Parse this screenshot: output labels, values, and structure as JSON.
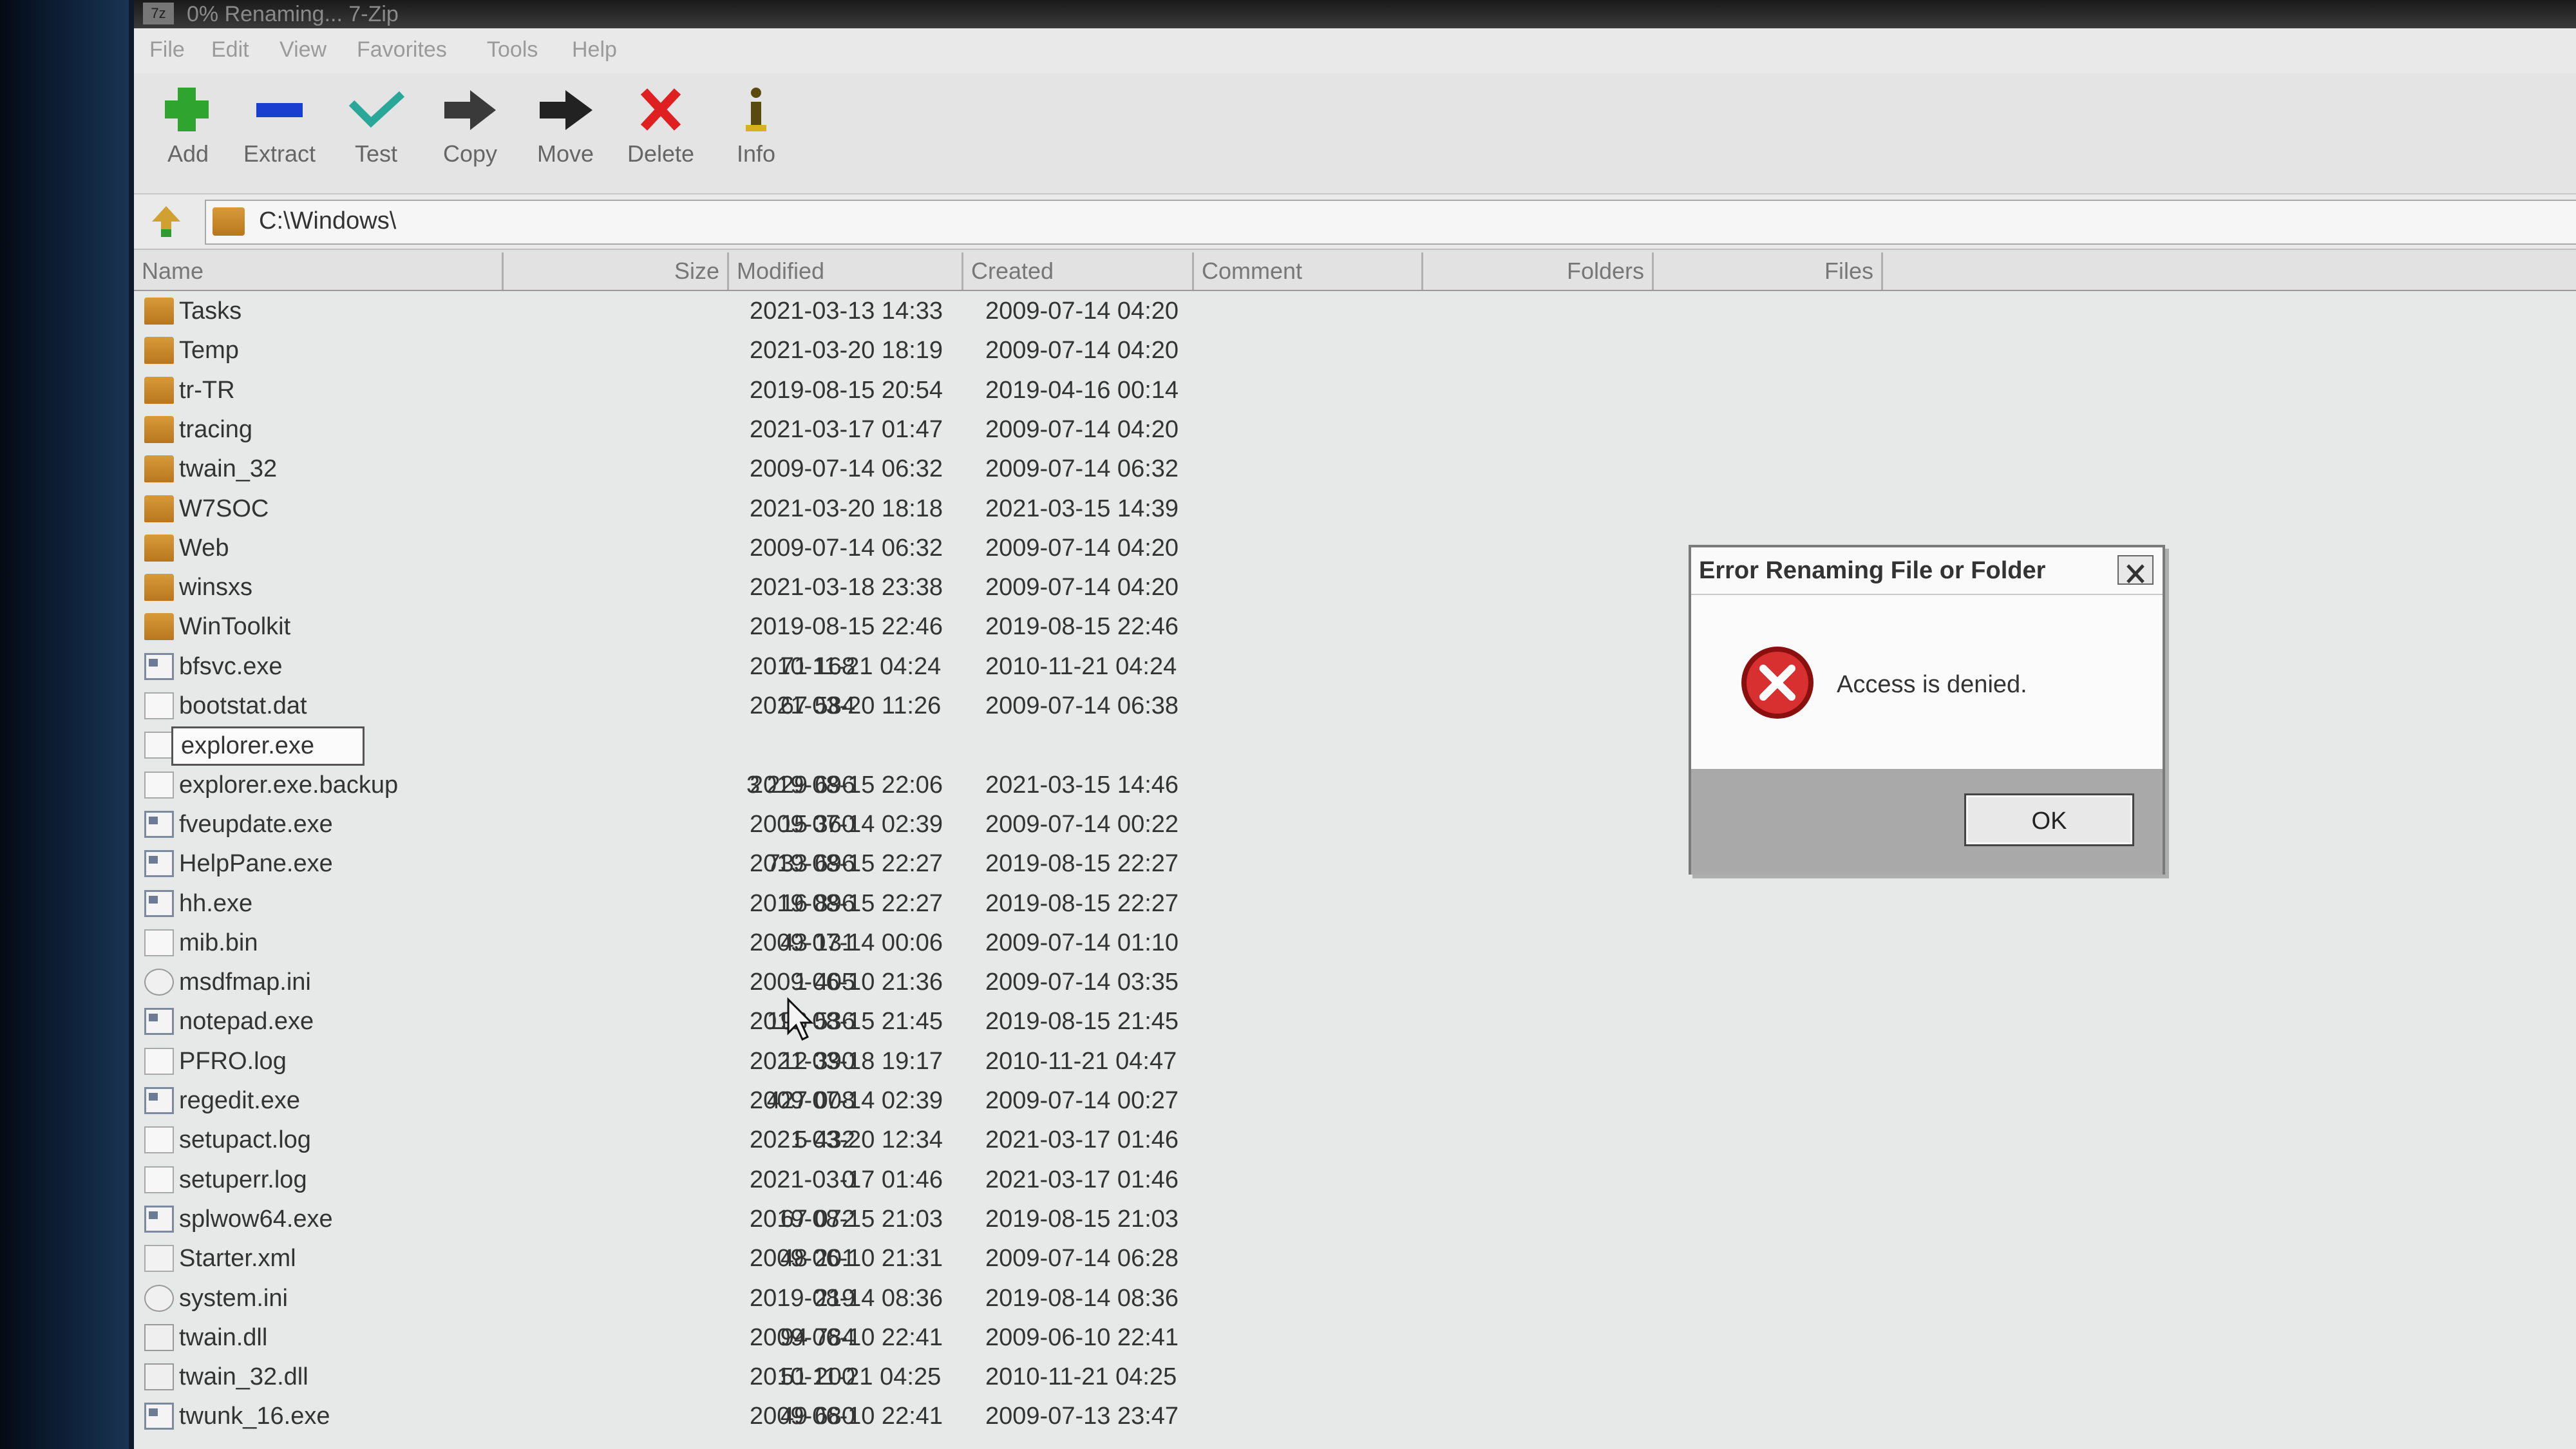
{
  "window": {
    "title": "0% Renaming... 7-Zip"
  },
  "menu": [
    "File",
    "Edit",
    "View",
    "Favorites",
    "Tools",
    "Help"
  ],
  "toolbar": {
    "add": "Add",
    "extract": "Extract",
    "test": "Test",
    "copy": "Copy",
    "move": "Move",
    "delete": "Delete",
    "info": "Info"
  },
  "address": {
    "path": "C:\\Windows\\"
  },
  "columns": {
    "name": "Name",
    "size": "Size",
    "modified": "Modified",
    "created": "Created",
    "comment": "Comment",
    "folders": "Folders",
    "files": "Files"
  },
  "files": [
    {
      "name": "Tasks",
      "type": "folder",
      "size": "",
      "modified": "2021-03-13 14:33",
      "created": "2009-07-14 04:20"
    },
    {
      "name": "Temp",
      "type": "folder",
      "size": "",
      "modified": "2021-03-20 18:19",
      "created": "2009-07-14 04:20"
    },
    {
      "name": "tr-TR",
      "type": "folder",
      "size": "",
      "modified": "2019-08-15 20:54",
      "created": "2019-04-16 00:14"
    },
    {
      "name": "tracing",
      "type": "folder",
      "size": "",
      "modified": "2021-03-17 01:47",
      "created": "2009-07-14 04:20"
    },
    {
      "name": "twain_32",
      "type": "folder",
      "size": "",
      "modified": "2009-07-14 06:32",
      "created": "2009-07-14 06:32"
    },
    {
      "name": "W7SOC",
      "type": "folder",
      "size": "",
      "modified": "2021-03-20 18:18",
      "created": "2021-03-15 14:39"
    },
    {
      "name": "Web",
      "type": "folder",
      "size": "",
      "modified": "2009-07-14 06:32",
      "created": "2009-07-14 04:20"
    },
    {
      "name": "winsxs",
      "type": "folder",
      "size": "",
      "modified": "2021-03-18 23:38",
      "created": "2009-07-14 04:20"
    },
    {
      "name": "WinToolkit",
      "type": "folder",
      "size": "",
      "modified": "2019-08-15 22:46",
      "created": "2019-08-15 22:46"
    },
    {
      "name": "bfsvc.exe",
      "type": "exe",
      "size": "71 168",
      "modified": "2010-11-21 04:24",
      "created": "2010-11-21 04:24"
    },
    {
      "name": "bootstat.dat",
      "type": "file",
      "size": "67 584",
      "modified": "2021-03-20 11:26",
      "created": "2009-07-14 06:38"
    },
    {
      "name": "explorer.exe",
      "type": "file",
      "size": "",
      "modified": "",
      "created": "",
      "editing": true
    },
    {
      "name": "explorer.exe.backup",
      "type": "file",
      "size": "3 229 696",
      "modified": "2019-08-15 22:06",
      "created": "2021-03-15 14:46"
    },
    {
      "name": "fveupdate.exe",
      "type": "exe",
      "size": "15 360",
      "modified": "2009-07-14 02:39",
      "created": "2009-07-14 00:22"
    },
    {
      "name": "HelpPane.exe",
      "type": "exe",
      "size": "733 696",
      "modified": "2019-08-15 22:27",
      "created": "2019-08-15 22:27"
    },
    {
      "name": "hh.exe",
      "type": "exe",
      "size": "16 896",
      "modified": "2019-08-15 22:27",
      "created": "2019-08-15 22:27"
    },
    {
      "name": "mib.bin",
      "type": "file",
      "size": "43 131",
      "modified": "2009-07-14 00:06",
      "created": "2009-07-14 01:10"
    },
    {
      "name": "msdfmap.ini",
      "type": "ini",
      "size": "1 405",
      "modified": "2009-06-10 21:36",
      "created": "2009-07-14 03:35"
    },
    {
      "name": "notepad.exe",
      "type": "exe",
      "size": "193 536",
      "modified": "2019-08-15 21:45",
      "created": "2019-08-15 21:45"
    },
    {
      "name": "PFRO.log",
      "type": "file",
      "size": "12 390",
      "modified": "2021-03-18 19:17",
      "created": "2010-11-21 04:47"
    },
    {
      "name": "regedit.exe",
      "type": "exe",
      "size": "427 008",
      "modified": "2009-07-14 02:39",
      "created": "2009-07-14 00:27"
    },
    {
      "name": "setupact.log",
      "type": "file",
      "size": "5 432",
      "modified": "2021-03-20 12:34",
      "created": "2021-03-17 01:46"
    },
    {
      "name": "setuperr.log",
      "type": "file",
      "size": "0",
      "modified": "2021-03-17 01:46",
      "created": "2021-03-17 01:46"
    },
    {
      "name": "splwow64.exe",
      "type": "exe",
      "size": "67 072",
      "modified": "2019-08-15 21:03",
      "created": "2019-08-15 21:03"
    },
    {
      "name": "Starter.xml",
      "type": "xml",
      "size": "48 201",
      "modified": "2009-06-10 21:31",
      "created": "2009-07-14 06:28"
    },
    {
      "name": "system.ini",
      "type": "ini",
      "size": "219",
      "modified": "2019-08-14 08:36",
      "created": "2019-08-14 08:36"
    },
    {
      "name": "twain.dll",
      "type": "dll",
      "size": "94 784",
      "modified": "2009-06-10 22:41",
      "created": "2009-06-10 22:41"
    },
    {
      "name": "twain_32.dll",
      "type": "dll",
      "size": "51 200",
      "modified": "2010-11-21 04:25",
      "created": "2010-11-21 04:25"
    },
    {
      "name": "twunk_16.exe",
      "type": "exe",
      "size": "49 680",
      "modified": "2009-06-10 22:41",
      "created": "2009-07-13 23:47"
    }
  ],
  "dialog": {
    "title": "Error Renaming File or Folder",
    "message": "Access is denied.",
    "ok": "OK"
  },
  "colors": {
    "delete_red": "#e02020",
    "add_green": "#2fa52f",
    "extract_blue": "#1a3fd0",
    "test_teal": "#29a89a",
    "folder_orange": "#c98a2c"
  }
}
